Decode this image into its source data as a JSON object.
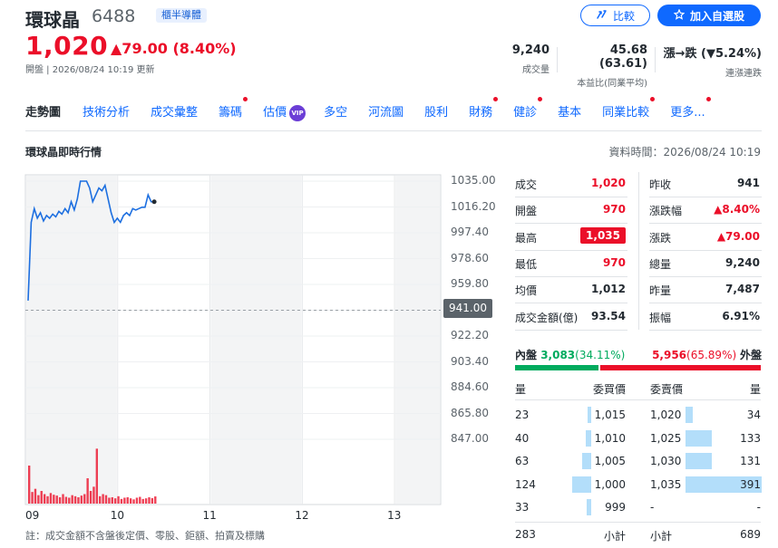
{
  "stock": {
    "name": "環球晶",
    "code": "6488",
    "tag": "櫃半導體"
  },
  "actions": {
    "compare": "比較",
    "add_watchlist": "加入自選股"
  },
  "quote": {
    "price": "1,020",
    "change": "▲79.00 (8.40%)",
    "status": "開盤 | 2026/08/24 10:19 更新"
  },
  "stats": [
    {
      "value": "9,240",
      "label": "成交量"
    },
    {
      "value": "45.68 (63.61)",
      "label": "本益比(同業平均)"
    },
    {
      "value": "漲→跌 (▼5.24%)",
      "label": "連漲連跌"
    }
  ],
  "tabs": [
    {
      "label": "走勢圖",
      "active": true,
      "dot": false
    },
    {
      "label": "技術分析",
      "dot": false
    },
    {
      "label": "成交彙整",
      "dot": false
    },
    {
      "label": "籌碼",
      "dot": true
    },
    {
      "label": "估價",
      "dot": false,
      "vip": "VIP"
    },
    {
      "label": "多空",
      "dot": false
    },
    {
      "label": "河流圖",
      "dot": false
    },
    {
      "label": "股利",
      "dot": false
    },
    {
      "label": "財務",
      "dot": true
    },
    {
      "label": "健診",
      "dot": true
    },
    {
      "label": "基本",
      "dot": false
    },
    {
      "label": "同業比較",
      "dot": true
    },
    {
      "label": "更多...",
      "dot": true
    }
  ],
  "section": {
    "title": "環球晶即時行情",
    "time": "資料時間：2026/08/24 10:19"
  },
  "chart_data": {
    "type": "line",
    "x_ticks": [
      "09",
      "10",
      "11",
      "12",
      "13"
    ],
    "y_ticks": [
      1035.0,
      1016.2,
      997.4,
      978.6,
      959.8,
      941.0,
      922.2,
      903.4,
      884.6,
      865.8,
      847.0
    ],
    "ylim": [
      847.0,
      1035.0
    ],
    "reference": 941.0,
    "reference_label": "941.00",
    "series": [
      {
        "x": [
          0,
          2,
          4,
          6,
          8,
          10,
          12,
          14,
          16,
          18,
          20,
          22,
          24,
          26,
          28,
          30,
          32,
          34,
          36,
          38,
          40,
          42,
          44,
          46,
          48,
          50,
          52,
          54,
          56,
          58,
          60,
          62,
          64,
          66,
          68,
          70,
          72,
          74,
          76,
          78,
          80,
          82
        ],
        "values": [
          948,
          1005,
          1015,
          1008,
          1012,
          1006,
          1010,
          1008,
          1011,
          1009,
          1013,
          1011,
          1015,
          1012,
          1020,
          1014,
          1022,
          1035,
          1035,
          1035,
          1030,
          1020,
          1025,
          1030,
          1028,
          1032,
          1022,
          1012,
          1005,
          1008,
          1005,
          1010,
          1012,
          1010,
          1015,
          1014,
          1015,
          1016,
          1016,
          1025,
          1020,
          1020
        ]
      }
    ],
    "volume": [
      180,
      55,
      70,
      40,
      60,
      45,
      35,
      50,
      42,
      38,
      30,
      45,
      32,
      28,
      40,
      35,
      30,
      38,
      45,
      120,
      60,
      80,
      260,
      35,
      45,
      40,
      28,
      30,
      25,
      35,
      22,
      28,
      30,
      25,
      20,
      28,
      32,
      22,
      25,
      30,
      26,
      34
    ]
  },
  "quote_table": {
    "left": [
      {
        "label": "成交",
        "value": "1,020",
        "color": "up"
      },
      {
        "label": "開盤",
        "value": "970",
        "color": "up"
      },
      {
        "label": "最高",
        "value": "1,035",
        "color": "highbox"
      },
      {
        "label": "最低",
        "value": "970",
        "color": "up"
      },
      {
        "label": "均價",
        "value": "1,012",
        "color": "neutral"
      },
      {
        "label": "成交金額(億)",
        "value": "93.54",
        "color": "neutral"
      }
    ],
    "right": [
      {
        "label": "昨收",
        "value": "941",
        "color": "neutral"
      },
      {
        "label": "漲跌幅",
        "value": "▲8.40%",
        "color": "up"
      },
      {
        "label": "漲跌",
        "value": "▲79.00",
        "color": "up"
      },
      {
        "label": "總量",
        "value": "9,240",
        "color": "neutral"
      },
      {
        "label": "昨量",
        "value": "7,487",
        "color": "neutral"
      },
      {
        "label": "振幅",
        "value": "6.91%",
        "color": "neutral"
      }
    ]
  },
  "inout": {
    "inner_label": "內盤",
    "inner_value": "3,083",
    "inner_pct": "(34.11%)",
    "inner_fraction": 0.3411,
    "outer_label": "外盤",
    "outer_value": "5,956",
    "outer_pct": "(65.89%)"
  },
  "orderbook": {
    "headers": {
      "bid_qty": "量",
      "bid_price": "委買價",
      "ask_price": "委賣價",
      "ask_qty": "量"
    },
    "rows": [
      {
        "bid_qty": "23",
        "bid_price": "1,015",
        "bid_frac": 0.06,
        "ask_price": "1,020",
        "ask_qty": "34",
        "ask_frac": 0.09
      },
      {
        "bid_qty": "40",
        "bid_price": "1,010",
        "bid_frac": 0.1,
        "ask_price": "1,025",
        "ask_qty": "133",
        "ask_frac": 0.34
      },
      {
        "bid_qty": "63",
        "bid_price": "1,005",
        "bid_frac": 0.16,
        "ask_price": "1,030",
        "ask_qty": "131",
        "ask_frac": 0.34
      },
      {
        "bid_qty": "124",
        "bid_price": "1,000",
        "bid_frac": 0.32,
        "ask_price": "1,035",
        "ask_qty": "391",
        "ask_frac": 1.0
      },
      {
        "bid_qty": "33",
        "bid_price": "999",
        "bid_frac": 0.08,
        "ask_price": "-",
        "ask_qty": "-",
        "ask_frac": 0
      }
    ],
    "footer": {
      "bid_total": "283",
      "bid_label": "小計",
      "ask_label": "小計",
      "ask_total": "689"
    }
  },
  "note": "註：成交金額不含盤後定價、零股、鉅額、拍賣及標購",
  "colors": {
    "up": "#eb0f29",
    "down": "#00ab5e",
    "line": "#1d6fe0",
    "accent": "#0f69ff"
  }
}
